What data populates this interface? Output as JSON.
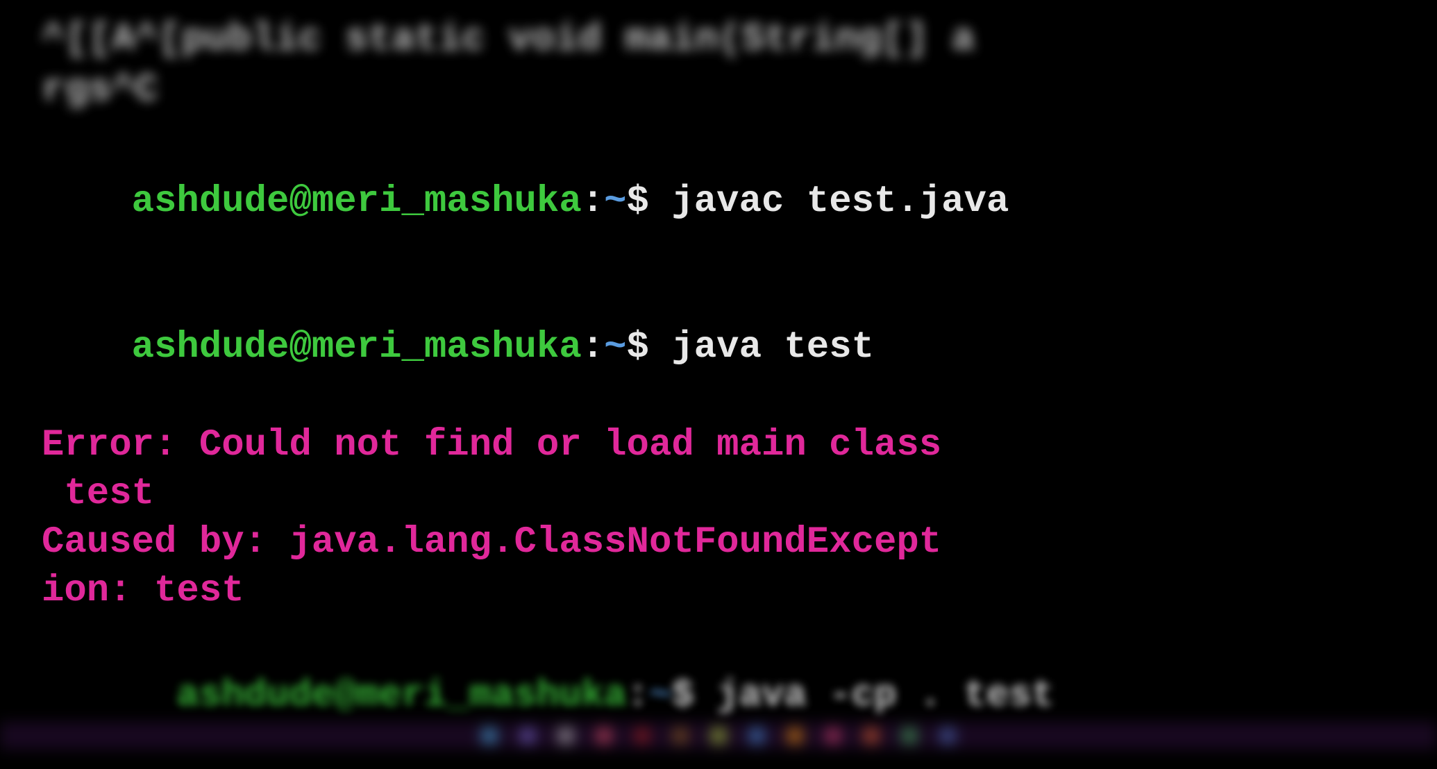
{
  "blurred_top": {
    "line1": "^[[A^[public static void main(String[] a",
    "line2": "rgs^C"
  },
  "prompt": {
    "user_host": "ashdude@meri_mashuka",
    "colon": ":",
    "path": "~",
    "dollar": "$ "
  },
  "lines": [
    {
      "command": "javac test.java"
    },
    {
      "command": "java test"
    }
  ],
  "error": {
    "line1": "Error: Could not find or load main class",
    "line2": " test",
    "line3": "Caused by: java.lang.ClassNotFoundExcept",
    "line4": "ion: test"
  },
  "blurred_bottom": {
    "command": "java -cp . test"
  },
  "dock_colors": [
    "#4ab0e8",
    "#7a68d0",
    "#c0c0c0",
    "#e0506a",
    "#a02020",
    "#906020",
    "#b0d040",
    "#4a90e0",
    "#f09010",
    "#d04070",
    "#e06030",
    "#4ab060",
    "#5070c0"
  ]
}
